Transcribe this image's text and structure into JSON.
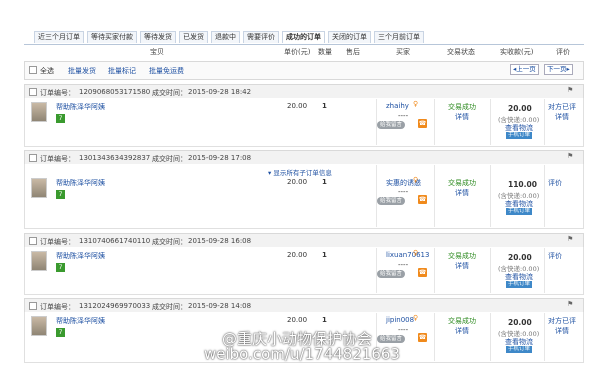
{
  "tabs": [
    "近三个月订单",
    "等待买家付款",
    "等待发货",
    "已发货",
    "退款中",
    "需要评价",
    "成功的订单",
    "关闭的订单",
    "三个月前订单"
  ],
  "active_tab": "成功的订单",
  "columns": {
    "item": "宝贝",
    "price": "单价(元)",
    "qty": "数量",
    "after_sale": "售后",
    "buyer": "买家",
    "status": "交易状态",
    "amount": "实收款(元)",
    "review": "评价"
  },
  "toolbar": {
    "select_all": "全选",
    "batch_ship": "批量发货",
    "batch_mark": "批量标记",
    "batch_free_ship": "批量免运费",
    "prev": "上一页",
    "next": "下一页"
  },
  "icons": {
    "flag": "flag-icon",
    "phone": "phone-icon",
    "ww": "wangwang-icon",
    "chat": "message-icon"
  },
  "colors": {
    "link": "#1e50a2",
    "success": "#2c8a1f",
    "button": "#3e88c8",
    "phone": "#f08a1c"
  },
  "orders": [
    {
      "order_label": "订单编号：",
      "order_no": "1209068053171580",
      "time_label": "成交时间：",
      "time": "2015-09-28 18:42",
      "title": "帮助陈泽华阿姨",
      "price": "20.00",
      "qty": "1",
      "buyer": "zhaihy",
      "dash": "----",
      "leave_msg": "给我留言",
      "status": "交易成功",
      "detail": "详情",
      "amount": "20.00",
      "shipping": "(含快递:0.00)",
      "view_logistics": "查看物流",
      "manual": "手机订单",
      "review": "对方已评",
      "review_detail": "详情",
      "show_sub": ""
    },
    {
      "order_label": "订单编号：",
      "order_no": "1301343634392837",
      "time_label": "成交时间：",
      "time": "2015-09-28 17:08",
      "title": "帮助陈泽华阿姨",
      "price": "20.00",
      "qty": "1",
      "buyer": "实惠的诱惑",
      "dash": "----",
      "leave_msg": "给我留言",
      "status": "交易成功",
      "detail": "详情",
      "amount": "110.00",
      "shipping": "(含快递:0.00)",
      "view_logistics": "查看物流",
      "manual": "手机订单",
      "review": "评价",
      "review_detail": "",
      "show_sub": "▾ 显示所有子订单信息"
    },
    {
      "order_label": "订单编号：",
      "order_no": "1310740661740110",
      "time_label": "成交时间：",
      "time": "2015-09-28 16:08",
      "title": "帮助陈泽华阿姨",
      "price": "20.00",
      "qty": "1",
      "buyer": "lixuan70613",
      "dash": "----",
      "leave_msg": "给我留言",
      "status": "交易成功",
      "detail": "详情",
      "amount": "20.00",
      "shipping": "(含快递:0.00)",
      "view_logistics": "查看物流",
      "manual": "手机订单",
      "review": "评价",
      "review_detail": "",
      "show_sub": ""
    },
    {
      "order_label": "订单编号：",
      "order_no": "1312024969970033",
      "time_label": "成交时间：",
      "time": "2015-09-28 14:08",
      "title": "帮助陈泽华阿姨",
      "price": "20.00",
      "qty": "1",
      "buyer": "jipin008",
      "dash": "----",
      "leave_msg": "给我留言",
      "status": "交易成功",
      "detail": "详情",
      "amount": "20.00",
      "shipping": "(含快递:0.00)",
      "view_logistics": "查看物流",
      "manual": "手机订单",
      "review": "对方已评",
      "review_detail": "详情",
      "show_sub": ""
    }
  ],
  "watermark": {
    "line1": "@重庆小动物保护协会",
    "line2": "weibo.com/u/1744821663"
  }
}
